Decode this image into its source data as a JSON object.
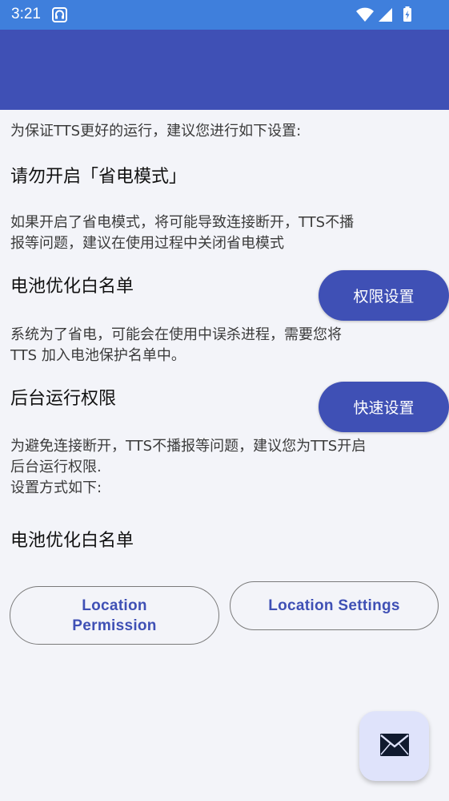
{
  "status_bar": {
    "time": "3:21",
    "icons": [
      "notification-icon",
      "wifi-icon",
      "cellular-signal-icon",
      "battery-charging-icon"
    ]
  },
  "content": {
    "intro": "为保证TTS更好的运行，建议您进行如下设置:",
    "power_saving": {
      "title": "请勿开启「省电模式」",
      "desc": "如果开启了省电模式，将可能导致连接断开，TTS不播\n报等问题，建议在使用过程中关闭省电模式"
    },
    "battery_whitelist": {
      "title": "电池优化白名单",
      "button": "权限设置",
      "desc": "系统为了省电，可能会在使用中误杀进程，需要您将\nTTS 加入电池保护名单中。"
    },
    "background": {
      "title": "后台运行权限",
      "button": "快速设置",
      "desc": "为避免连接断开，TTS不播报等问题，建议您为TTS开启\n后台运行权限.\n设置方式如下:"
    },
    "battery_whitelist_2": {
      "title": "电池优化白名单"
    },
    "location_permission": "Location\nPermission",
    "location_settings": "Location Settings"
  },
  "fab": {
    "icon": "mail-icon"
  },
  "colors": {
    "status_bar": "#3f7fdc",
    "primary": "#3f50b5",
    "background": "#f3f4f9",
    "fab": "#dfe3fb"
  }
}
